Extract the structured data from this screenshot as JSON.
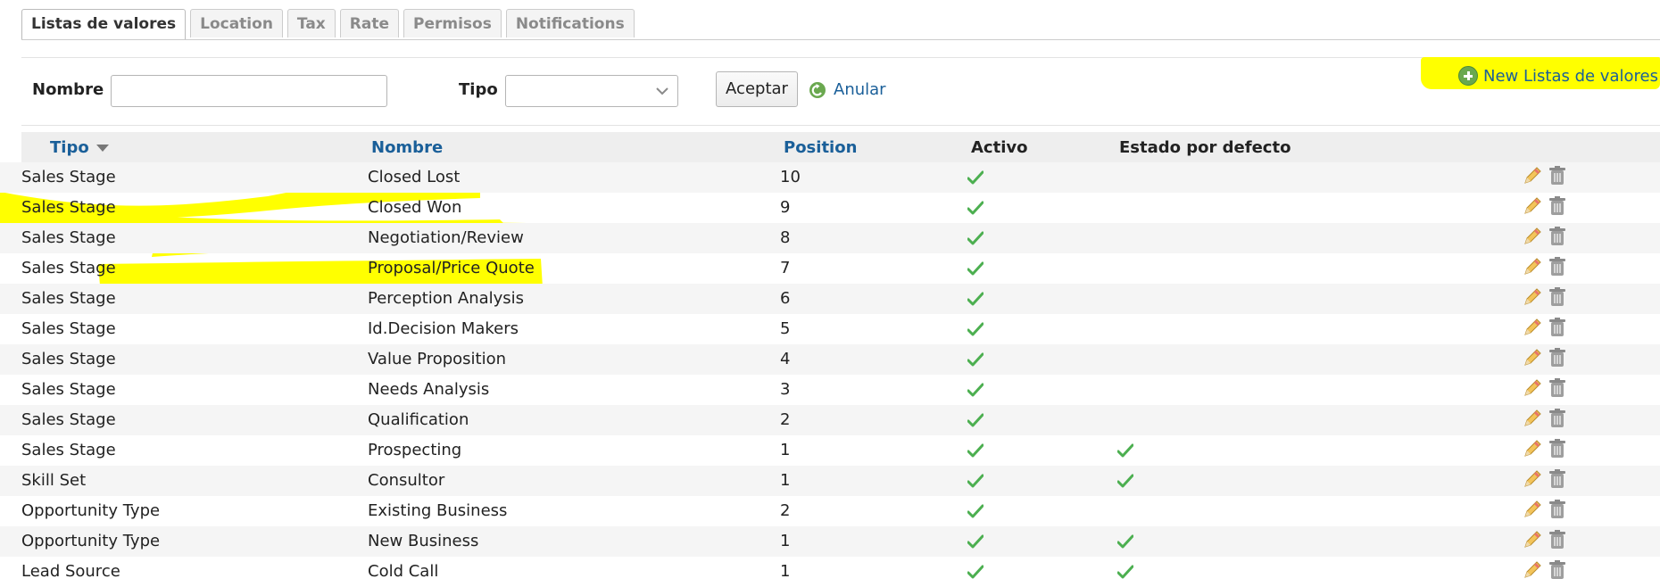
{
  "tabs": [
    {
      "label": "Listas de valores",
      "active": true
    },
    {
      "label": "Location",
      "active": false
    },
    {
      "label": "Tax",
      "active": false
    },
    {
      "label": "Rate",
      "active": false
    },
    {
      "label": "Permisos",
      "active": false
    },
    {
      "label": "Notifications",
      "active": false
    }
  ],
  "filter": {
    "nombre_label": "Nombre",
    "nombre_value": "",
    "tipo_label": "Tipo",
    "tipo_value": "",
    "accept_label": "Aceptar",
    "cancel_label": "Anular"
  },
  "new_button_label": "New Listas de valores",
  "columns": {
    "tipo": "Tipo",
    "nombre": "Nombre",
    "position": "Position",
    "activo": "Activo",
    "estado": "Estado por defecto"
  },
  "rows": [
    {
      "tipo": "Sales Stage",
      "nombre": "Closed Lost",
      "position": "10",
      "activo": true,
      "default": false
    },
    {
      "tipo": "Sales Stage",
      "nombre": "Closed Won",
      "position": "9",
      "activo": true,
      "default": false
    },
    {
      "tipo": "Sales Stage",
      "nombre": "Negotiation/Review",
      "position": "8",
      "activo": true,
      "default": false
    },
    {
      "tipo": "Sales Stage",
      "nombre": "Proposal/Price Quote",
      "position": "7",
      "activo": true,
      "default": false
    },
    {
      "tipo": "Sales Stage",
      "nombre": "Perception Analysis",
      "position": "6",
      "activo": true,
      "default": false
    },
    {
      "tipo": "Sales Stage",
      "nombre": "Id.Decision Makers",
      "position": "5",
      "activo": true,
      "default": false
    },
    {
      "tipo": "Sales Stage",
      "nombre": "Value Proposition",
      "position": "4",
      "activo": true,
      "default": false
    },
    {
      "tipo": "Sales Stage",
      "nombre": "Needs Analysis",
      "position": "3",
      "activo": true,
      "default": false
    },
    {
      "tipo": "Sales Stage",
      "nombre": "Qualification",
      "position": "2",
      "activo": true,
      "default": false
    },
    {
      "tipo": "Sales Stage",
      "nombre": "Prospecting",
      "position": "1",
      "activo": true,
      "default": true
    },
    {
      "tipo": "Skill Set",
      "nombre": "Consultor",
      "position": "1",
      "activo": true,
      "default": true
    },
    {
      "tipo": "Opportunity Type",
      "nombre": "Existing Business",
      "position": "2",
      "activo": true,
      "default": false
    },
    {
      "tipo": "Opportunity Type",
      "nombre": "New Business",
      "position": "1",
      "activo": true,
      "default": true
    },
    {
      "tipo": "Lead Source",
      "nombre": "Cold Call",
      "position": "1",
      "activo": true,
      "default": true
    }
  ],
  "colors": {
    "link": "#1a5f99",
    "highlight": "#ffff00",
    "check": "#4caf50"
  },
  "icons": {
    "sort": "sort-desc-icon",
    "edit": "pencil-icon",
    "delete": "trash-icon",
    "cancel": "undo-icon",
    "new": "plus-circle-icon"
  }
}
